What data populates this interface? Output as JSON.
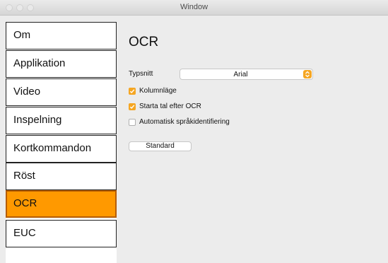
{
  "window": {
    "title": "Window"
  },
  "sidebar": {
    "items": [
      {
        "label": "Om"
      },
      {
        "label": "Applikation"
      },
      {
        "label": "Video"
      },
      {
        "label": "Inspelning"
      },
      {
        "label": "Kortkommandon"
      },
      {
        "label": "Röst"
      },
      {
        "label": "OCR",
        "active": true
      },
      {
        "label": "EUC"
      }
    ]
  },
  "main": {
    "heading": "OCR",
    "font_label": "Typsnitt",
    "font_value": "Arial",
    "checkboxes": [
      {
        "label": "Kolumnläge",
        "checked": true
      },
      {
        "label": "Starta tal efter OCR",
        "checked": true
      },
      {
        "label": "Automatisk språkidentifiering",
        "checked": false
      }
    ],
    "default_button": "Standard"
  },
  "colors": {
    "accent": "#ff9900",
    "checkbox": "#f5a623",
    "active_border": "#b55d00"
  }
}
